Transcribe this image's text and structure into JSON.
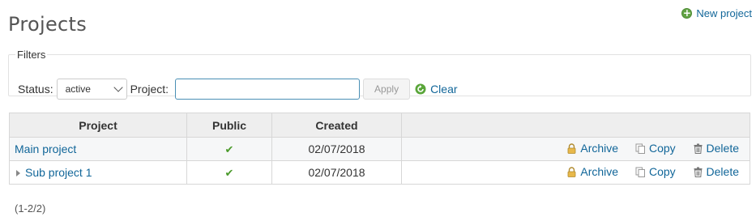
{
  "page": {
    "title": "Projects"
  },
  "header": {
    "new_project_label": "New project"
  },
  "filters": {
    "legend": "Filters",
    "status_label": "Status:",
    "status_value": "active",
    "project_label": "Project:",
    "project_value": "",
    "apply_label": "Apply",
    "clear_label": "Clear"
  },
  "table": {
    "headers": {
      "project": "Project",
      "public": "Public",
      "created": "Created"
    },
    "rows": [
      {
        "name": "Main project",
        "public": true,
        "created": "02/07/2018",
        "archive": "Archive",
        "copy": "Copy",
        "delete": "Delete"
      },
      {
        "name": "Sub project 1",
        "public": true,
        "created": "02/07/2018",
        "archive": "Archive",
        "copy": "Copy",
        "delete": "Delete"
      }
    ]
  },
  "pagination": {
    "text": "(1-2/2)"
  },
  "icons": {
    "new_project": "plus-circle-icon",
    "clear": "reload-icon",
    "archive": "lock-icon",
    "copy": "copy-icon",
    "delete": "trash-icon",
    "public": "checkmark-icon"
  },
  "colors": {
    "link": "#116699",
    "check": "#4a9a2a",
    "plus": "#62a344"
  }
}
